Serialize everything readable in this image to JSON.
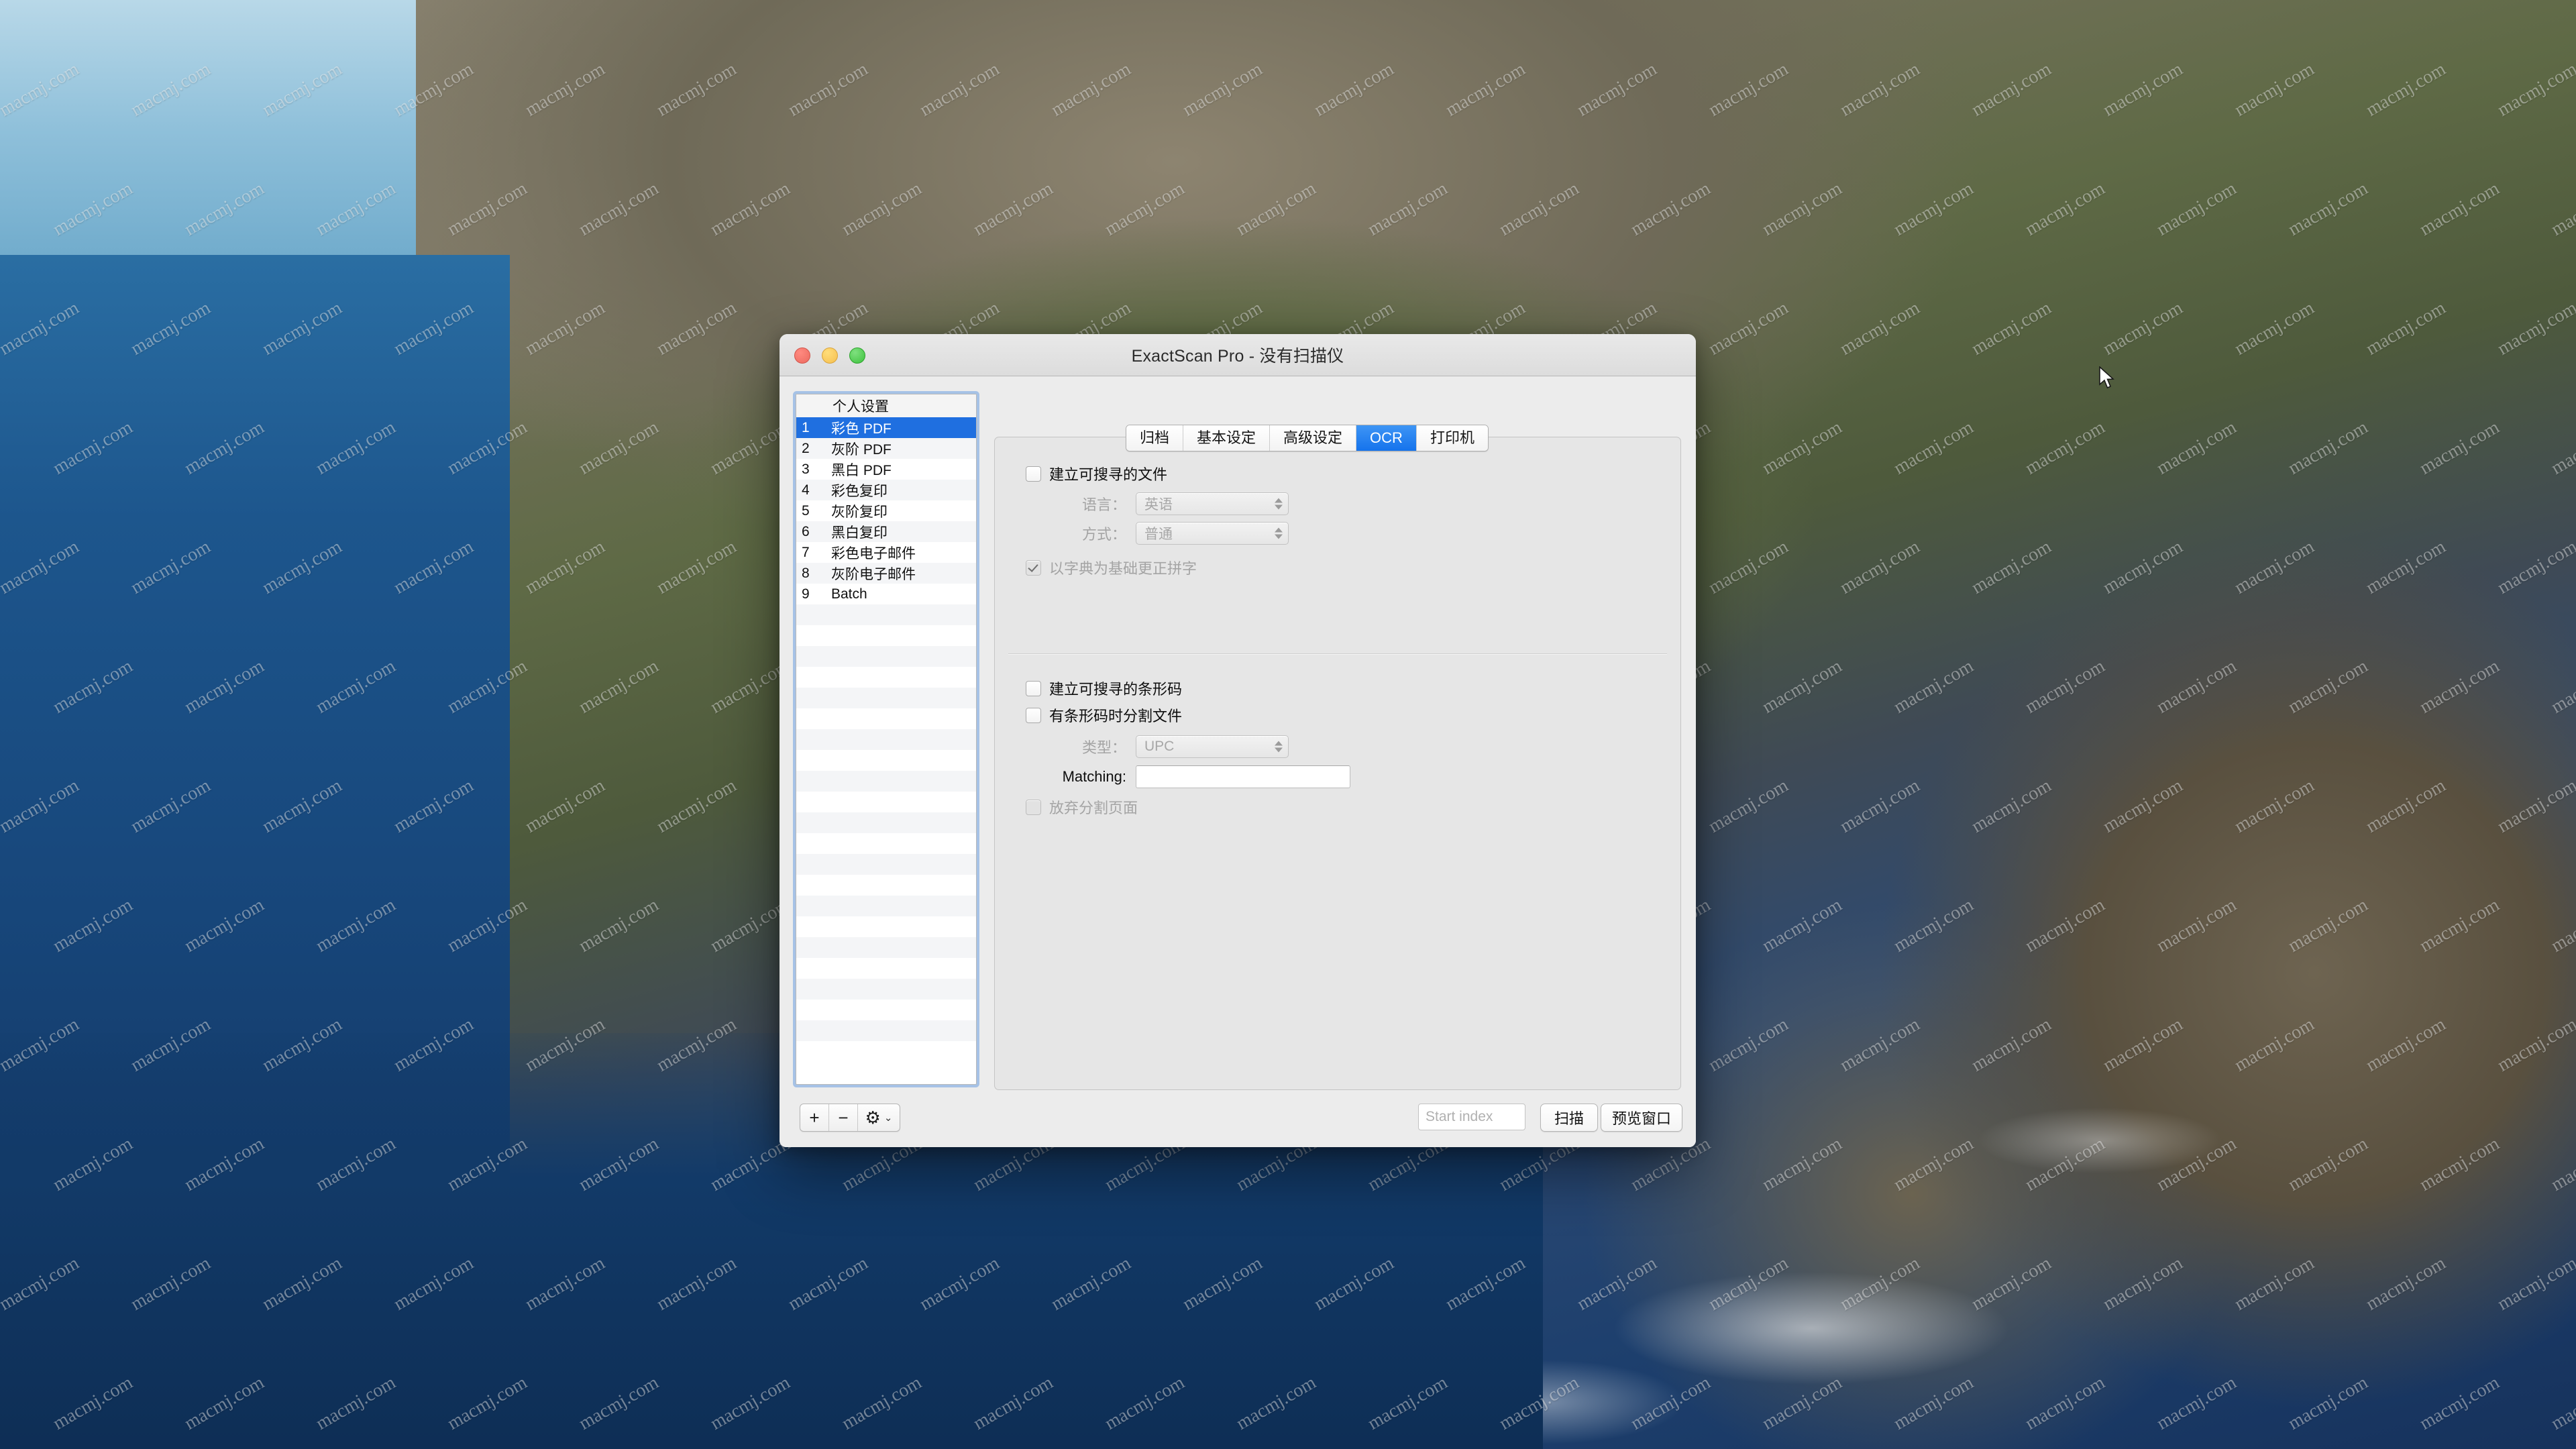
{
  "window": {
    "title": "ExactScan Pro - 没有扫描仪",
    "traffic_lights": [
      "close",
      "minimize",
      "zoom"
    ]
  },
  "sidebar": {
    "header_label": "个人设置",
    "items": [
      {
        "num": "1",
        "label": "彩色 PDF",
        "selected": true
      },
      {
        "num": "2",
        "label": "灰阶 PDF",
        "selected": false
      },
      {
        "num": "3",
        "label": "黑白 PDF",
        "selected": false
      },
      {
        "num": "4",
        "label": "彩色复印",
        "selected": false
      },
      {
        "num": "5",
        "label": "灰阶复印",
        "selected": false
      },
      {
        "num": "6",
        "label": "黑白复印",
        "selected": false
      },
      {
        "num": "7",
        "label": "彩色电子邮件",
        "selected": false
      },
      {
        "num": "8",
        "label": "灰阶电子邮件",
        "selected": false
      },
      {
        "num": "9",
        "label": "Batch",
        "selected": false
      }
    ]
  },
  "tabs": [
    {
      "label": "归档",
      "active": false
    },
    {
      "label": "基本设定",
      "active": false
    },
    {
      "label": "高级设定",
      "active": false
    },
    {
      "label": "OCR",
      "active": true
    },
    {
      "label": "打印机",
      "active": false
    }
  ],
  "ocr_panel": {
    "searchable_file_checkbox": {
      "label": "建立可搜寻的文件",
      "checked": false
    },
    "language": {
      "label": "语言：",
      "value": "英语"
    },
    "mode": {
      "label": "方式：",
      "value": "普通"
    },
    "dictionary_checkbox": {
      "label": "以字典为基础更正拼字",
      "checked": true,
      "disabled": true
    },
    "searchable_barcode_checkbox": {
      "label": "建立可搜寻的条形码",
      "checked": false
    },
    "split_on_barcode_checkbox": {
      "label": "有条形码时分割文件",
      "checked": false
    },
    "type": {
      "label": "类型：",
      "value": "UPC"
    },
    "matching": {
      "label": "Matching:",
      "value": ""
    },
    "discard_split_page_checkbox": {
      "label": "放弃分割页面",
      "checked": false,
      "disabled": true
    }
  },
  "bottom_bar": {
    "add_label": "+",
    "remove_label": "−",
    "gear_label": "⚙",
    "gear_chevron": "⌄",
    "start_index_placeholder": "Start index",
    "start_index_value": "",
    "scan_label": "扫描",
    "preview_label": "预览窗口"
  },
  "colors": {
    "accent": "#1573ec",
    "selection": "#1f6fe0",
    "window_bg": "#ececec",
    "panel_bg": "#e6e6e6"
  },
  "watermark": {
    "text": "macmj.com"
  }
}
